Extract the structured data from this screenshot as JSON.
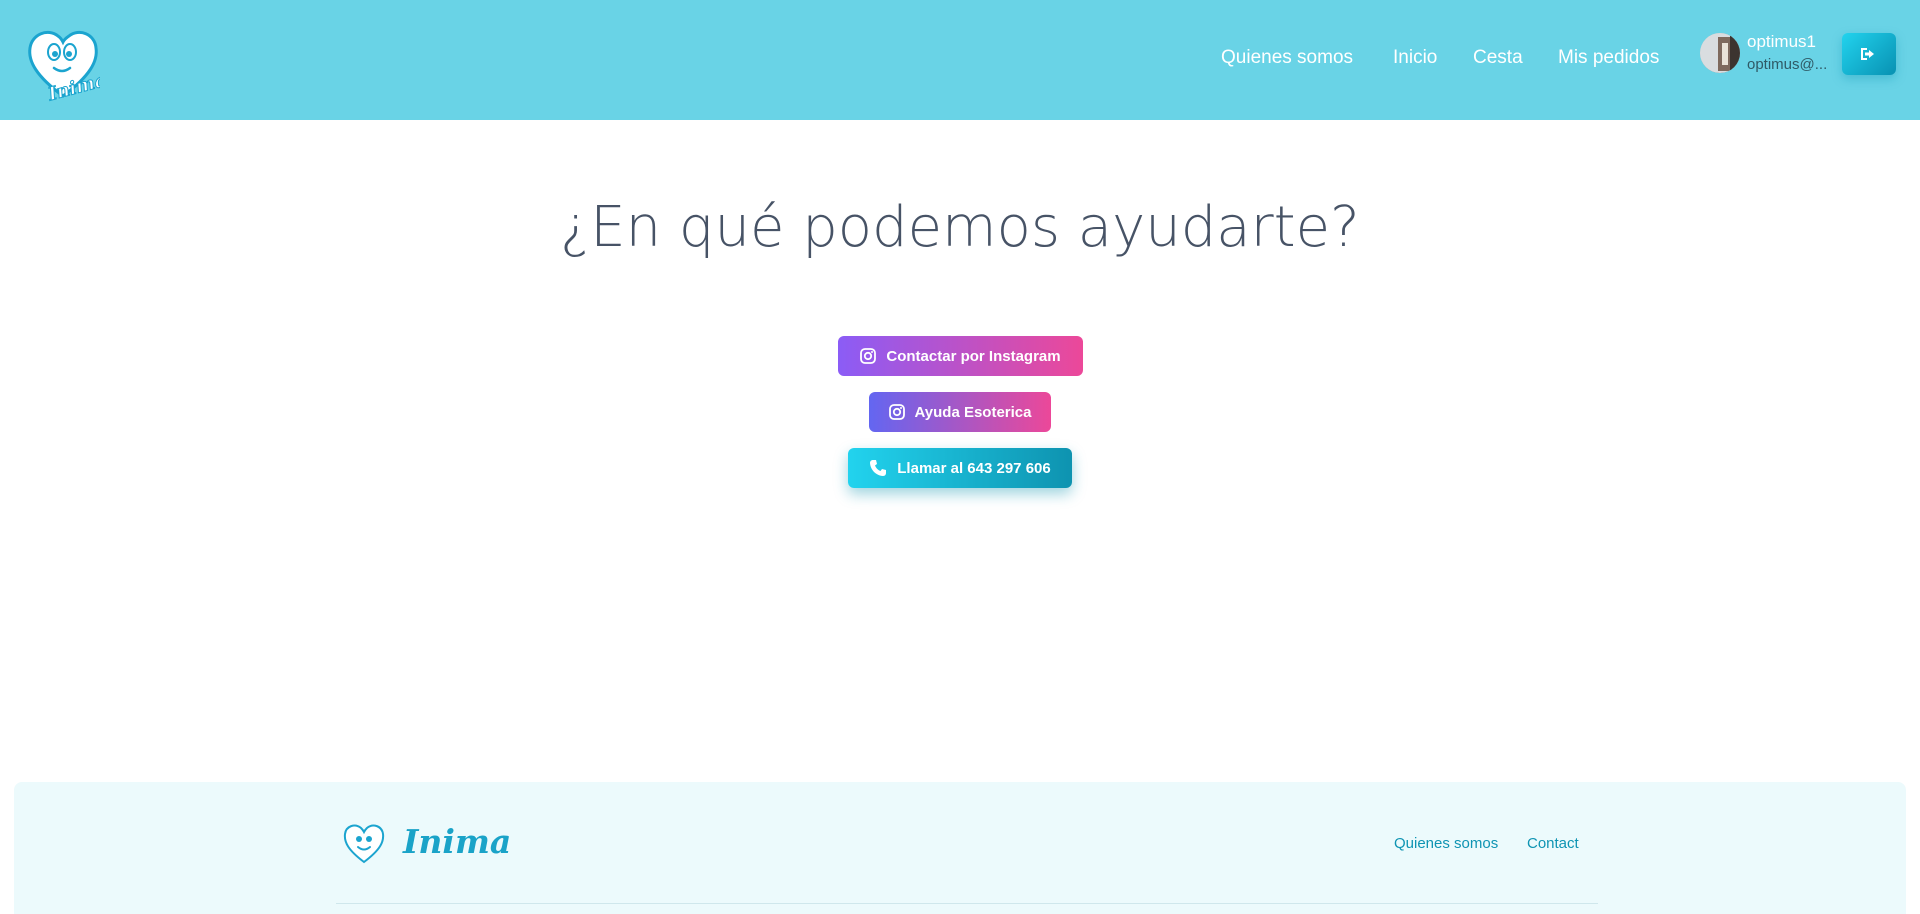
{
  "header": {
    "logo_text": "Inima",
    "nav": [
      {
        "label": "Quienes somos"
      },
      {
        "label": "Inicio"
      },
      {
        "label": "Cesta"
      },
      {
        "label": "Mis pedidos"
      }
    ],
    "user": {
      "name": "optimus1",
      "email": "optimus@..."
    },
    "logout_icon": "sign-out-icon"
  },
  "main": {
    "title": "¿En qué podemos ayudarte?",
    "buttons": [
      {
        "label": "Contactar por Instagram",
        "icon": "instagram-icon"
      },
      {
        "label": "Ayuda Esoterica",
        "icon": "instagram-icon"
      },
      {
        "label": "Llamar al 643 297 606",
        "icon": "phone-icon"
      }
    ]
  },
  "footer": {
    "brand": "Inima",
    "links": [
      {
        "label": "Quienes somos"
      },
      {
        "label": "Contact"
      }
    ]
  },
  "colors": {
    "header_bg": "#69d3e6",
    "footer_bg": "#ecfafc",
    "title": "#475366",
    "accent": "#0891b2"
  }
}
